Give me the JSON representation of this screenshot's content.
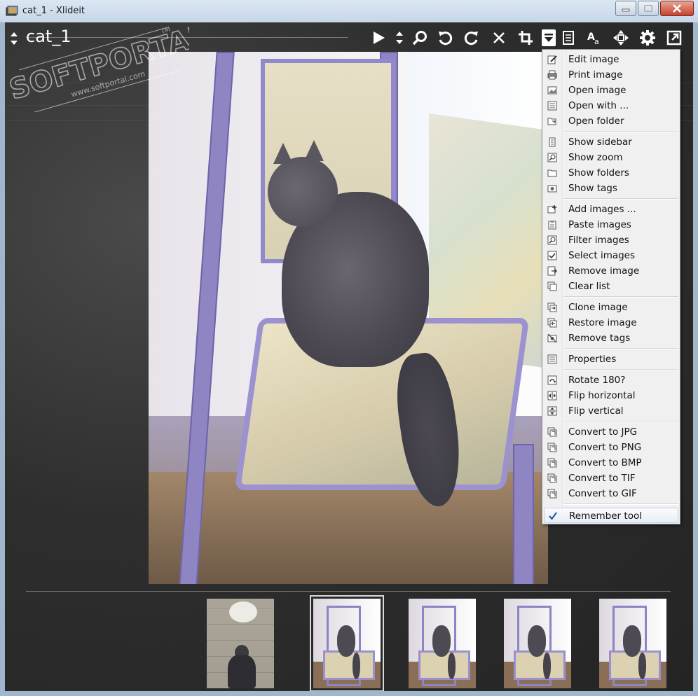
{
  "window": {
    "title": "cat_1 - Xlideit",
    "minimize_icon": "minimize-icon",
    "maximize_icon": "maximize-icon",
    "close_icon": "close-icon"
  },
  "toolbar": {
    "image_title": "cat_1",
    "buttons": [
      {
        "name": "play-icon"
      },
      {
        "name": "updown-icon"
      },
      {
        "name": "zoom-icon"
      },
      {
        "name": "rotate-left-icon"
      },
      {
        "name": "rotate-right-icon"
      },
      {
        "name": "close-image-icon"
      },
      {
        "name": "crop-icon"
      },
      {
        "name": "menu-dropdown-icon"
      },
      {
        "name": "sidebar-icon"
      },
      {
        "name": "font-icon"
      },
      {
        "name": "fit-icon"
      },
      {
        "name": "gear-icon"
      },
      {
        "name": "fullscreen-icon"
      }
    ]
  },
  "menu": {
    "groups": [
      [
        {
          "label": "Edit image",
          "icon": "edit-icon"
        },
        {
          "label": "Print image",
          "icon": "print-icon"
        },
        {
          "label": "Open image",
          "icon": "open-image-icon"
        },
        {
          "label": "Open with ...",
          "icon": "open-with-icon"
        },
        {
          "label": "Open folder",
          "icon": "open-folder-icon"
        }
      ],
      [
        {
          "label": "Show sidebar",
          "icon": "sidebar-icon"
        },
        {
          "label": "Show zoom",
          "icon": "zoom-icon"
        },
        {
          "label": "Show folders",
          "icon": "folder-icon"
        },
        {
          "label": "Show tags",
          "icon": "tag-icon"
        }
      ],
      [
        {
          "label": "Add images ...",
          "icon": "add-images-icon"
        },
        {
          "label": "Paste images",
          "icon": "paste-icon"
        },
        {
          "label": "Filter images",
          "icon": "filter-icon"
        },
        {
          "label": "Select images",
          "icon": "select-icon"
        },
        {
          "label": "Remove image",
          "icon": "remove-image-icon"
        },
        {
          "label": "Clear list",
          "icon": "clear-list-icon"
        }
      ],
      [
        {
          "label": "Clone image",
          "icon": "clone-icon"
        },
        {
          "label": "Restore image",
          "icon": "restore-icon"
        },
        {
          "label": "Remove tags",
          "icon": "remove-tags-icon"
        }
      ],
      [
        {
          "label": "Properties",
          "icon": "properties-icon"
        }
      ],
      [
        {
          "label": "Rotate 180?",
          "icon": "rotate-180-icon"
        },
        {
          "label": "Flip horizontal",
          "icon": "flip-horizontal-icon"
        },
        {
          "label": "Flip vertical",
          "icon": "flip-vertical-icon"
        }
      ],
      [
        {
          "label": "Convert to JPG",
          "icon": "convert-icon"
        },
        {
          "label": "Convert to PNG",
          "icon": "convert-icon"
        },
        {
          "label": "Convert to BMP",
          "icon": "convert-icon"
        },
        {
          "label": "Convert to TIF",
          "icon": "convert-icon"
        },
        {
          "label": "Convert to GIF",
          "icon": "convert-icon"
        }
      ]
    ],
    "remember": {
      "label": "Remember tool",
      "checked": true,
      "icon": "checkmark-icon"
    }
  },
  "thumbnails": [
    {
      "name": "thumbnail-street",
      "selected": false
    },
    {
      "name": "thumbnail-cat-1",
      "selected": true
    },
    {
      "name": "thumbnail-cat-2",
      "selected": false
    },
    {
      "name": "thumbnail-cat-3",
      "selected": false
    },
    {
      "name": "thumbnail-cat-4",
      "selected": false
    }
  ],
  "watermark": {
    "brand": "SOFTPORTAL",
    "url": "www.softportal.com",
    "tm": "TM"
  },
  "colors": {
    "background": "#2e2e2e",
    "menu_bg": "#f0f0f0",
    "check": "#1f5fb0"
  }
}
